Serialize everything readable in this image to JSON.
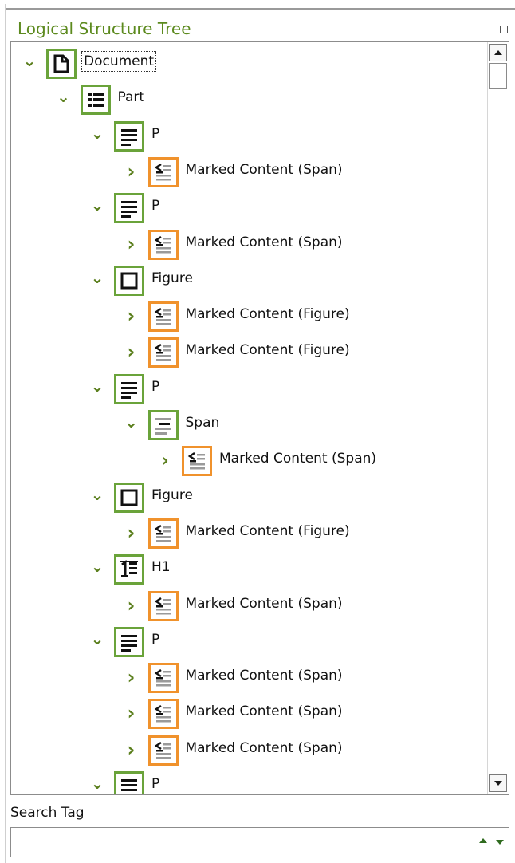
{
  "panel": {
    "title": "Logical Structure Tree"
  },
  "tree": {
    "rows": [
      {
        "level": 0,
        "expanded": true,
        "icon": "document-icon",
        "frame": "green",
        "label": "Document",
        "selected": true
      },
      {
        "level": 1,
        "expanded": true,
        "icon": "part-icon",
        "frame": "green",
        "label": "Part"
      },
      {
        "level": 2,
        "expanded": true,
        "icon": "paragraph-icon",
        "frame": "green",
        "label": "P"
      },
      {
        "level": 3,
        "expanded": false,
        "icon": "marked-content-icon",
        "frame": "orange",
        "label": "Marked Content (Span)"
      },
      {
        "level": 2,
        "expanded": true,
        "icon": "paragraph-icon",
        "frame": "green",
        "label": "P"
      },
      {
        "level": 3,
        "expanded": false,
        "icon": "marked-content-icon",
        "frame": "orange",
        "label": "Marked Content (Span)"
      },
      {
        "level": 2,
        "expanded": true,
        "icon": "figure-icon",
        "frame": "green",
        "label": "Figure"
      },
      {
        "level": 3,
        "expanded": false,
        "icon": "marked-content-icon",
        "frame": "orange",
        "label": "Marked Content (Figure)"
      },
      {
        "level": 3,
        "expanded": false,
        "icon": "marked-content-icon",
        "frame": "orange",
        "label": "Marked Content (Figure)"
      },
      {
        "level": 2,
        "expanded": true,
        "icon": "paragraph-icon",
        "frame": "green",
        "label": "P"
      },
      {
        "level": 3,
        "expanded": true,
        "icon": "span-icon",
        "frame": "green",
        "label": "Span"
      },
      {
        "level": 4,
        "expanded": false,
        "icon": "marked-content-icon",
        "frame": "orange",
        "label": "Marked Content (Span)"
      },
      {
        "level": 2,
        "expanded": true,
        "icon": "figure-icon",
        "frame": "green",
        "label": "Figure"
      },
      {
        "level": 3,
        "expanded": false,
        "icon": "marked-content-icon",
        "frame": "orange",
        "label": "Marked Content (Figure)"
      },
      {
        "level": 2,
        "expanded": true,
        "icon": "heading1-icon",
        "frame": "green",
        "label": "H1"
      },
      {
        "level": 3,
        "expanded": false,
        "icon": "marked-content-icon",
        "frame": "orange",
        "label": "Marked Content (Span)"
      },
      {
        "level": 2,
        "expanded": true,
        "icon": "paragraph-icon",
        "frame": "green",
        "label": "P"
      },
      {
        "level": 3,
        "expanded": false,
        "icon": "marked-content-icon",
        "frame": "orange",
        "label": "Marked Content (Span)"
      },
      {
        "level": 3,
        "expanded": false,
        "icon": "marked-content-icon",
        "frame": "orange",
        "label": "Marked Content (Span)"
      },
      {
        "level": 3,
        "expanded": false,
        "icon": "marked-content-icon",
        "frame": "orange",
        "label": "Marked Content (Span)"
      },
      {
        "level": 2,
        "expanded": true,
        "icon": "paragraph-icon",
        "frame": "green",
        "label": "P"
      }
    ]
  },
  "search": {
    "label": "Search Tag",
    "value": ""
  },
  "colors": {
    "title": "#5c8a1e",
    "green_frame": "#6aa33a",
    "orange_frame": "#f0922c",
    "chevron": "#5b7f1d"
  }
}
